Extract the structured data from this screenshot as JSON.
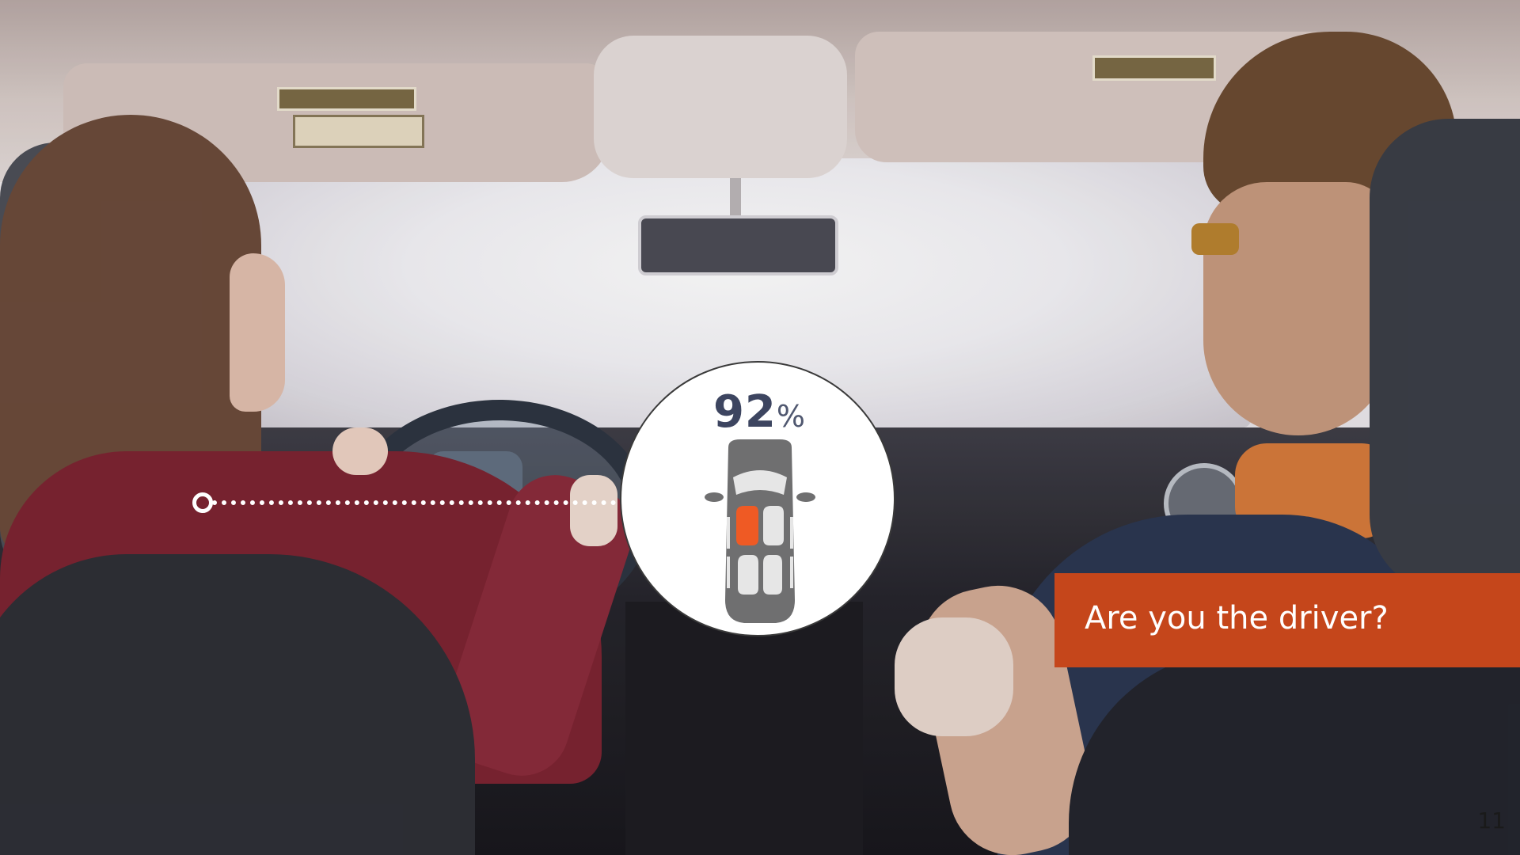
{
  "stat": {
    "value": "92",
    "unit": "%",
    "highlighted_seat": "driver",
    "accent_color": "#ef5a24"
  },
  "question": {
    "text": "Are you the driver?",
    "background_color": "#c5461b"
  },
  "page_number": "11",
  "colors": {
    "stat_text": "#3d4560",
    "car_body": "#6f6f70",
    "seat_fill": "#e6e6e6"
  }
}
